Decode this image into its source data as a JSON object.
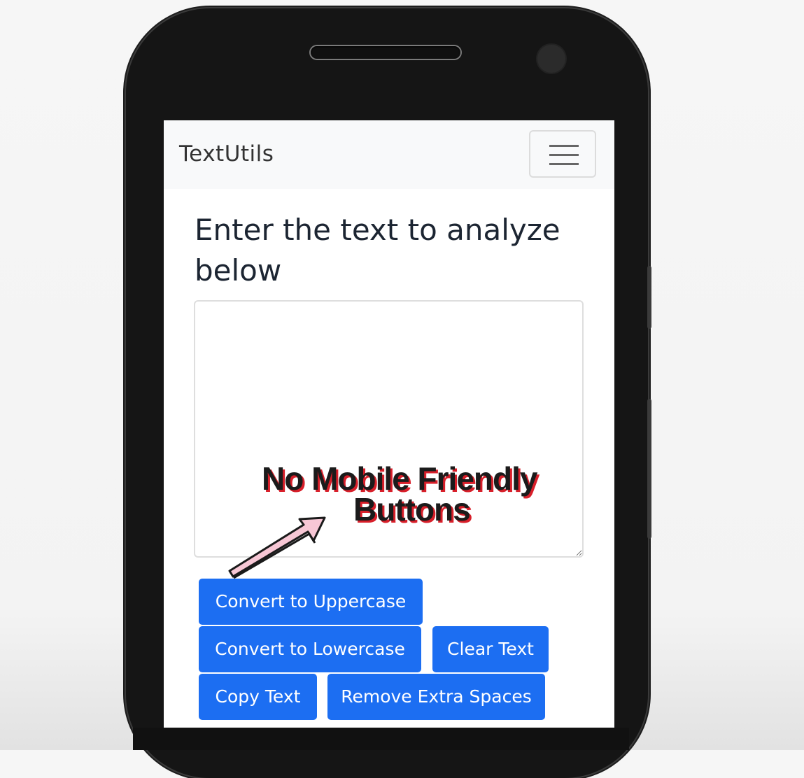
{
  "app": {
    "brand": "TextUtils"
  },
  "navbar": {
    "toggler_icon": "hamburger-icon"
  },
  "main": {
    "heading": "Enter the text to analyze below",
    "textarea_value": ""
  },
  "buttons": {
    "uppercase": "Convert to Uppercase",
    "lowercase": "Convert to Lowercase",
    "clear": "Clear Text",
    "copy": "Copy Text",
    "remove_spaces": "Remove Extra Spaces"
  },
  "annotation": {
    "line1": "No Mobile Friendly",
    "line2": "Buttons"
  },
  "colors": {
    "primary": "#1c6ef2",
    "navbar_bg": "#f8f9fa",
    "annotation_text": "#1b1b1b",
    "annotation_shadow": "#d81f2a",
    "arrow_fill": "#f7c7d5"
  }
}
